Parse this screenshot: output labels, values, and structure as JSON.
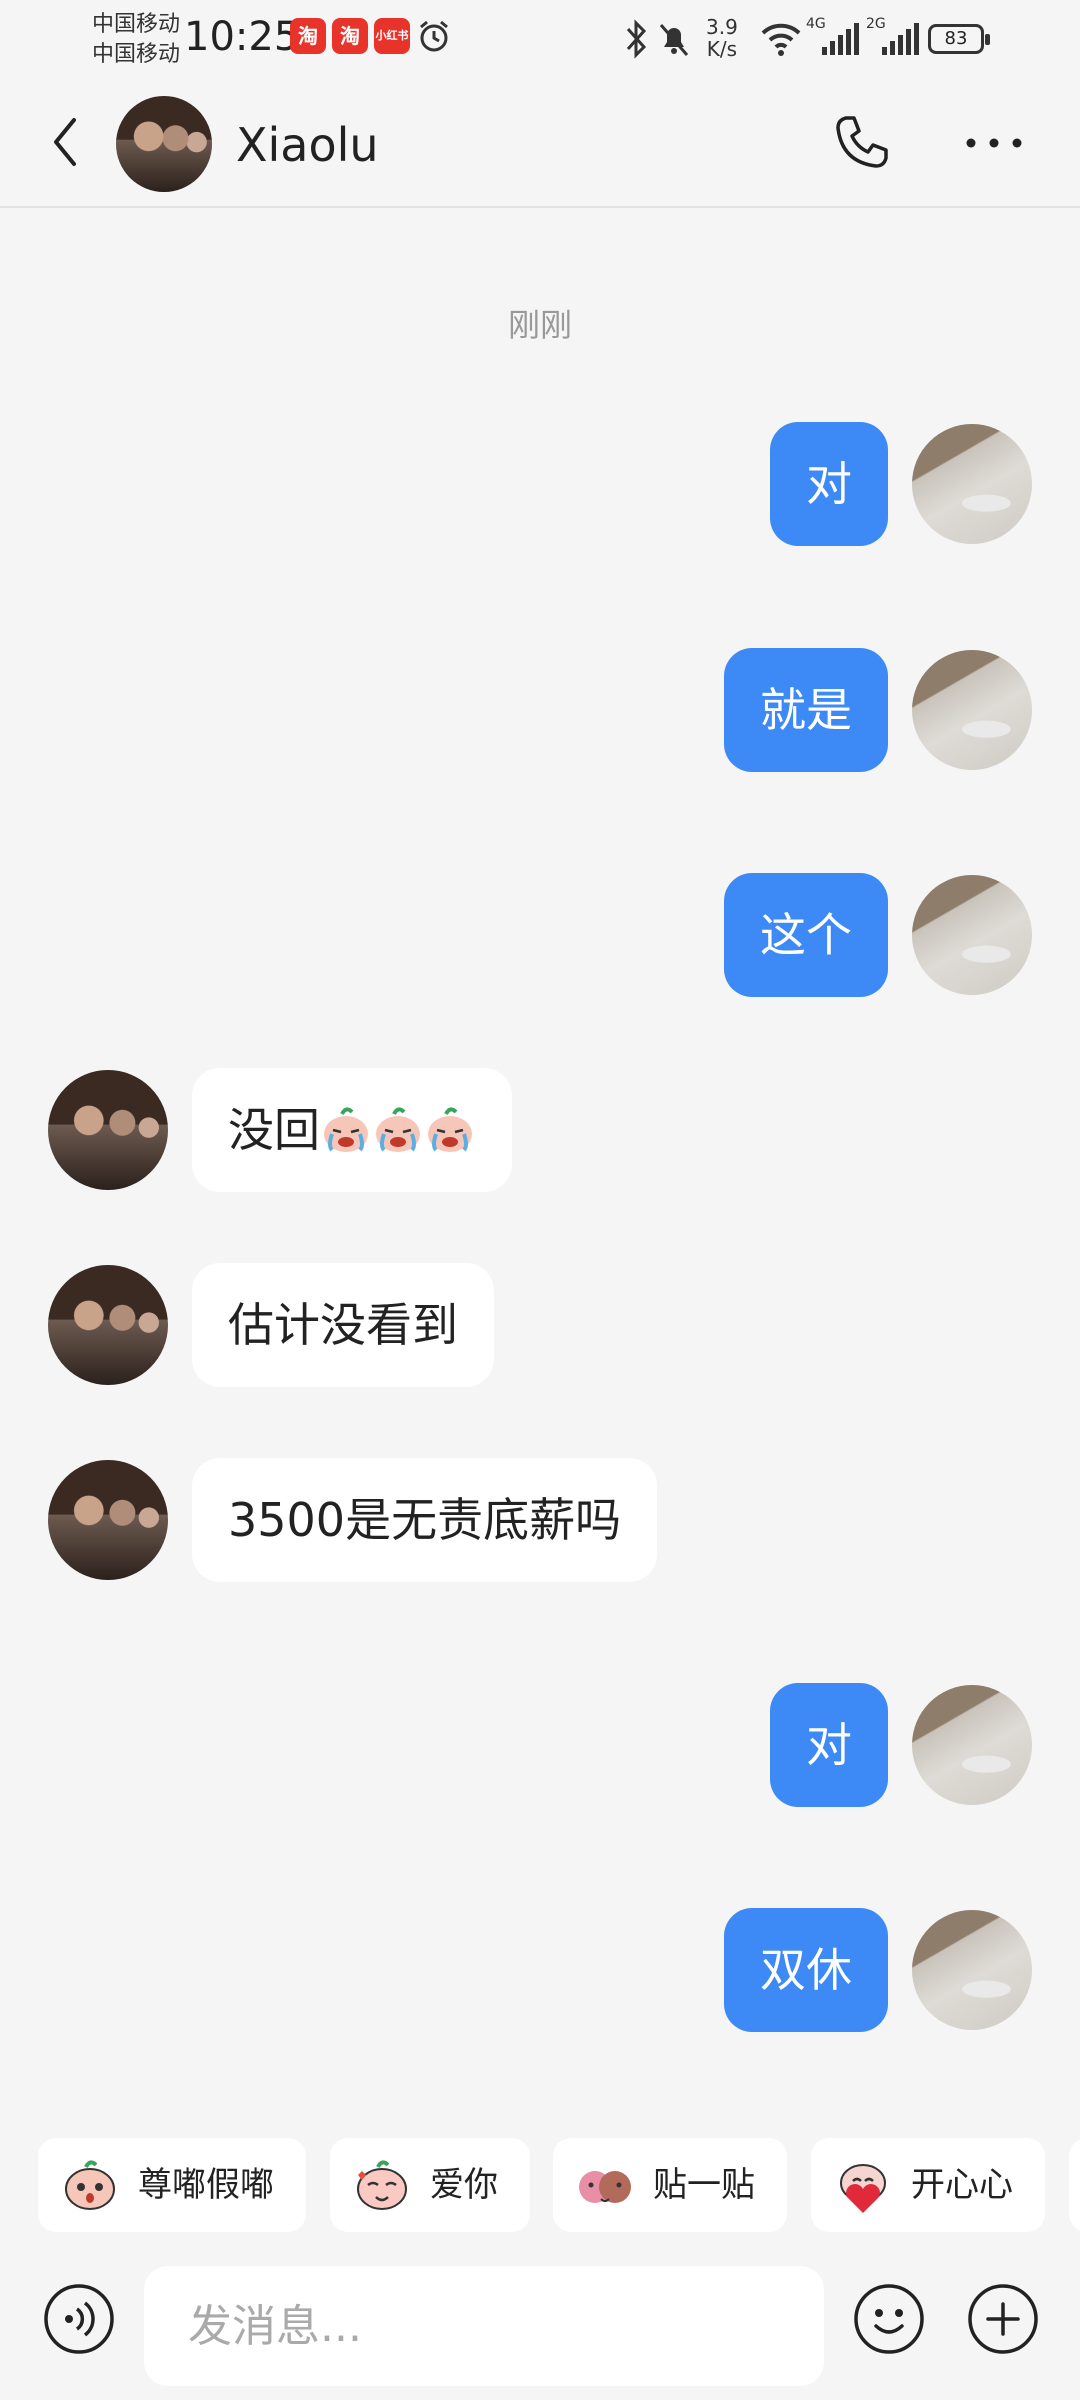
{
  "status_bar": {
    "carrier_1": "中国移动",
    "carrier_2": "中国移动",
    "time": "10:25",
    "app_badges": [
      "淘",
      "淘",
      "小红书"
    ],
    "network_speed_value": "3.9",
    "network_speed_unit": "K/s",
    "signal_1_label": "4G",
    "signal_2_label": "2G",
    "battery": "83"
  },
  "header": {
    "contact_name": "Xiaolu"
  },
  "conversation": {
    "timestamp": "刚刚",
    "messages": [
      {
        "sender": "me",
        "text": "对"
      },
      {
        "sender": "me",
        "text": "就是"
      },
      {
        "sender": "me",
        "text": "这个"
      },
      {
        "sender": "friend",
        "text": "没回",
        "emoji_count": 3,
        "emoji_icon": "crying-peach-face-icon"
      },
      {
        "sender": "friend",
        "text": "估计没看到"
      },
      {
        "sender": "friend",
        "text": "3500是无责底薪吗"
      },
      {
        "sender": "me",
        "text": "对"
      },
      {
        "sender": "me",
        "text": "双休"
      }
    ]
  },
  "sticker_suggestions": [
    {
      "label": "尊嘟假嘟",
      "icon": "peach-face-icon"
    },
    {
      "label": "爱你",
      "icon": "peach-love-icon"
    },
    {
      "label": "贴一贴",
      "icon": "cuddle-couple-icon"
    },
    {
      "label": "开心心",
      "icon": "happy-heart-icon"
    }
  ],
  "composer": {
    "placeholder": "发消息..."
  },
  "colors": {
    "my_bubble": "#3d8af7",
    "their_bubble": "#ffffff",
    "background": "#f5f5f5"
  }
}
